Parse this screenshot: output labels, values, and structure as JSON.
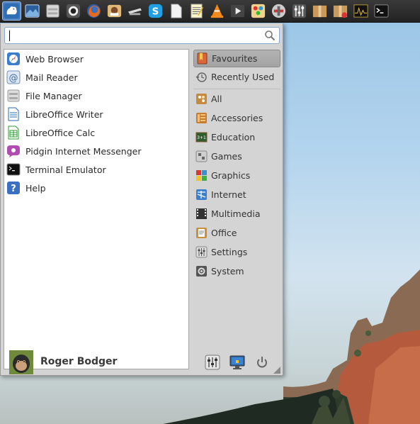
{
  "panel": {
    "launchers": [
      {
        "name": "xfce-menu-icon"
      },
      {
        "name": "desktop-icon"
      },
      {
        "name": "file-manager-icon"
      },
      {
        "name": "camera-icon"
      },
      {
        "name": "firefox-icon"
      },
      {
        "name": "mail-icon"
      },
      {
        "name": "steam-icon"
      },
      {
        "name": "skype-icon"
      },
      {
        "name": "document-icon"
      },
      {
        "name": "text-editor-icon"
      },
      {
        "name": "vlc-icon"
      },
      {
        "name": "video-player-icon"
      },
      {
        "name": "paint-icon"
      },
      {
        "name": "network-icon"
      },
      {
        "name": "mixer-icon"
      },
      {
        "name": "package-icon"
      },
      {
        "name": "package-installer-icon"
      },
      {
        "name": "system-monitor-icon"
      },
      {
        "name": "terminal-icon"
      }
    ]
  },
  "search": {
    "value": "",
    "placeholder": ""
  },
  "favourites": [
    {
      "label": "Web Browser",
      "icon": "web-browser-icon"
    },
    {
      "label": "Mail Reader",
      "icon": "mail-reader-icon"
    },
    {
      "label": "File Manager",
      "icon": "file-manager-icon"
    },
    {
      "label": "LibreOffice Writer",
      "icon": "libreoffice-writer-icon"
    },
    {
      "label": "LibreOffice Calc",
      "icon": "libreoffice-calc-icon"
    },
    {
      "label": "Pidgin Internet Messenger",
      "icon": "pidgin-icon"
    },
    {
      "label": "Terminal Emulator",
      "icon": "terminal-icon"
    },
    {
      "label": "Help",
      "icon": "help-icon"
    }
  ],
  "categories": {
    "top": [
      {
        "label": "Favourites",
        "icon": "favourites-icon",
        "selected": true
      },
      {
        "label": "Recently Used",
        "icon": "recently-used-icon",
        "selected": false
      }
    ],
    "list": [
      {
        "label": "All",
        "icon": "all-icon"
      },
      {
        "label": "Accessories",
        "icon": "accessories-icon"
      },
      {
        "label": "Education",
        "icon": "education-icon"
      },
      {
        "label": "Games",
        "icon": "games-icon"
      },
      {
        "label": "Graphics",
        "icon": "graphics-icon"
      },
      {
        "label": "Internet",
        "icon": "internet-icon"
      },
      {
        "label": "Multimedia",
        "icon": "multimedia-icon"
      },
      {
        "label": "Office",
        "icon": "office-icon"
      },
      {
        "label": "Settings",
        "icon": "settings-icon"
      },
      {
        "label": "System",
        "icon": "system-icon"
      }
    ]
  },
  "footer": {
    "username": "Roger Bodger",
    "buttons": [
      "settings-manager-icon",
      "lock-screen-icon",
      "log-out-icon"
    ]
  },
  "colors": {
    "selection": "#a8a8a8",
    "panel": "#2b2b2b",
    "accent": "#4d7fbf"
  }
}
